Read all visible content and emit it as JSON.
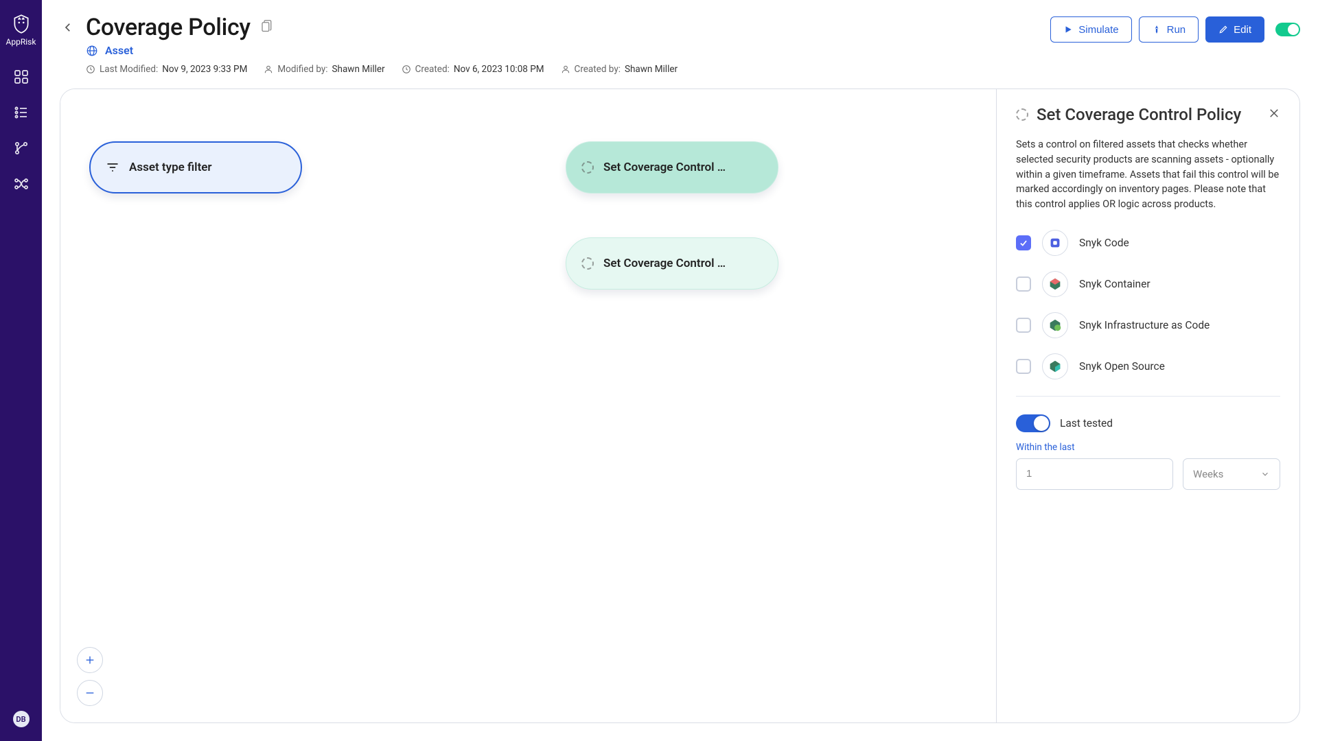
{
  "sidebar": {
    "app_name": "AppRisk",
    "avatar_initials": "DB"
  },
  "header": {
    "title": "Coverage Policy",
    "breadcrumb": "Asset",
    "simulate_label": "Simulate",
    "run_label": "Run",
    "edit_label": "Edit",
    "meta": {
      "modified_label": "Last Modified:",
      "modified_value": "Nov 9, 2023 9:33 PM",
      "modified_by_label": "Modified by:",
      "modified_by_value": "Shawn Miller",
      "created_label": "Created:",
      "created_value": "Nov 6, 2023 10:08 PM",
      "created_by_label": "Created by:",
      "created_by_value": "Shawn Miller"
    }
  },
  "nodes": {
    "filter": "Asset type filter",
    "action_a": "Set Coverage Control …",
    "action_b": "Set Coverage Control …"
  },
  "panel": {
    "title": "Set Coverage Control Policy",
    "description": "Sets a control on filtered assets that checks whether selected security products are scanning assets - optionally within a given timeframe. Assets that fail this control will be marked accordingly on inventory pages. Please note that this control applies OR logic across products.",
    "products": [
      {
        "label": "Snyk Code",
        "checked": true
      },
      {
        "label": "Snyk Container",
        "checked": false
      },
      {
        "label": "Snyk Infrastructure as Code",
        "checked": false
      },
      {
        "label": "Snyk Open Source",
        "checked": false
      }
    ],
    "last_tested_label": "Last tested",
    "within_label": "Within the last",
    "within_value": "1",
    "within_unit": "Weeks"
  }
}
